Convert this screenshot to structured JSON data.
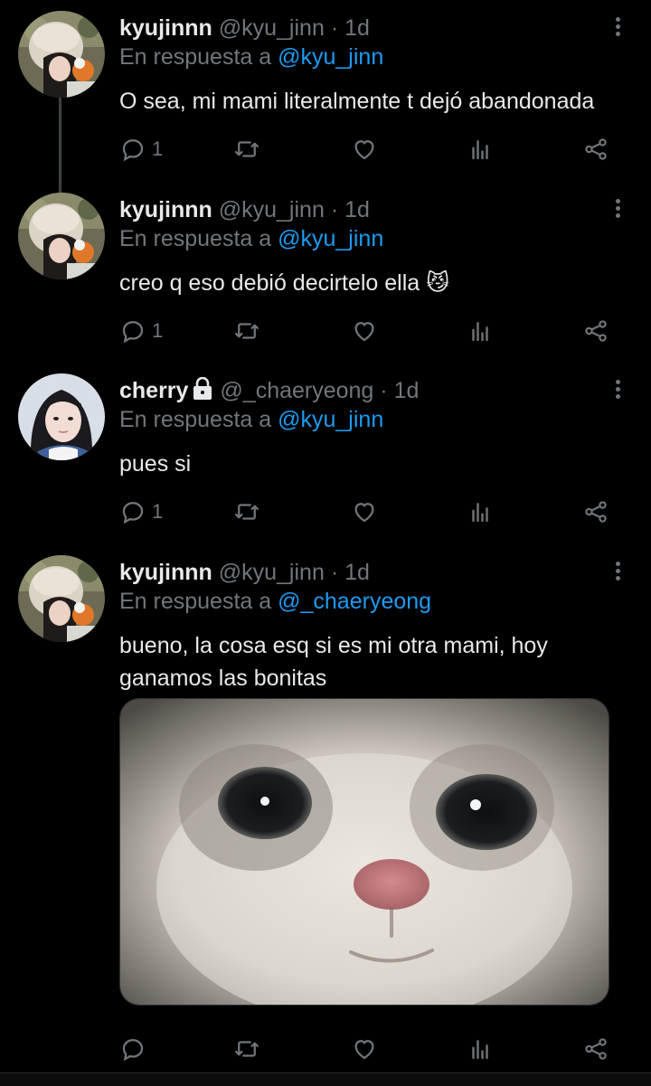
{
  "tweets": [
    {
      "name": "kyujinnn",
      "handle": "@kyu_jinn",
      "time": "1d",
      "reply_prefix": "En respuesta a",
      "reply_to": "@kyu_jinn",
      "text": "O sea, mi mami literalmente t dejó abandonada",
      "reply_count": "1"
    },
    {
      "name": "kyujinnn",
      "handle": "@kyu_jinn",
      "time": "1d",
      "reply_prefix": "En respuesta a",
      "reply_to": "@kyu_jinn",
      "text": "creo q eso debió decirtelo ella 😼",
      "reply_count": "1"
    },
    {
      "name": "cherry",
      "handle": "@_chaeryeong",
      "time": "1d",
      "reply_prefix": "En respuesta a",
      "reply_to": "@kyu_jinn",
      "text": "pues si",
      "reply_count": "1"
    },
    {
      "name": "kyujinnn",
      "handle": "@kyu_jinn",
      "time": "1d",
      "reply_prefix": "En respuesta a",
      "reply_to": "@_chaeryeong",
      "text": "bueno, la cosa esq si es mi otra mami, hoy ganamos las bonitas",
      "reply_count": ""
    }
  ],
  "separator": "·",
  "icons": {
    "reply": "reply-icon",
    "retweet": "retweet-icon",
    "like": "heart-icon",
    "views": "views-icon",
    "share": "share-icon",
    "more": "more-icon",
    "lock": "lock-icon"
  },
  "colors": {
    "background": "#000000",
    "text": "#e7e9ea",
    "muted": "#71767b",
    "link": "#1d9bf0"
  }
}
